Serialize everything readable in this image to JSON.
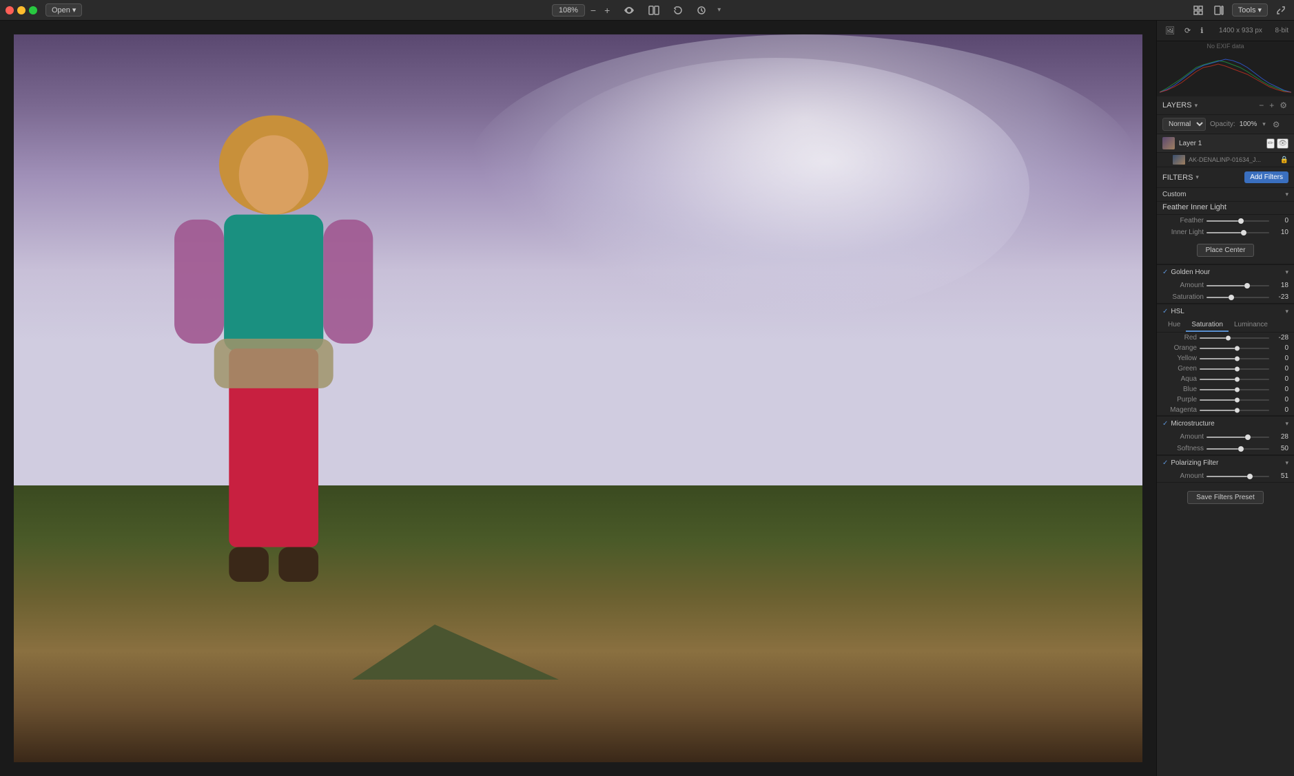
{
  "toolbar": {
    "open_label": "Open",
    "zoom_value": "108%",
    "zoom_minus": "−",
    "zoom_plus": "+",
    "tools_label": "Tools",
    "eye_icon": "👁",
    "compare_icon": "⊟",
    "undo_icon": "↺",
    "clock_icon": "⏱",
    "grid_icon": "⊞",
    "panel_icon": "▦",
    "resize_icon": "⤢"
  },
  "info_bar": {
    "size": "1400 x 933 px",
    "bit": "8-bit",
    "no_exif": "No EXIF data"
  },
  "layers": {
    "title": "LAYERS",
    "blend_mode": "Normal",
    "opacity_label": "Opacity:",
    "opacity_value": "100%",
    "layer1_name": "Layer 1",
    "file_name": "AK-DENALINP-01634_J...",
    "lock_icon": "🔒"
  },
  "filters": {
    "title": "FILTERS",
    "add_btn": "Add Filters",
    "custom_label": "Custom",
    "filter_name": "Feather Inner Light",
    "feather_label": "Feather",
    "feather_value": "0",
    "feather_pct": 50,
    "inner_light_label": "Inner Light",
    "inner_light_value": "10",
    "inner_light_pct": 55,
    "place_center": "Place Center"
  },
  "golden_hour": {
    "title": "Golden Hour",
    "amount_label": "Amount",
    "amount_value": "18",
    "amount_pct": 60,
    "saturation_label": "Saturation",
    "saturation_value": "-23",
    "saturation_pct": 35
  },
  "hsl": {
    "title": "HSL",
    "tabs": [
      "Hue",
      "Saturation",
      "Luminance"
    ],
    "active_tab": 1,
    "colors": [
      {
        "label": "Red",
        "value": "-28",
        "pct": 38
      },
      {
        "label": "Orange",
        "value": "0",
        "pct": 50
      },
      {
        "label": "Yellow",
        "value": "0",
        "pct": 50
      },
      {
        "label": "Green",
        "value": "0",
        "pct": 50
      },
      {
        "label": "Aqua",
        "value": "0",
        "pct": 50
      },
      {
        "label": "Blue",
        "value": "0",
        "pct": 50
      },
      {
        "label": "Purple",
        "value": "0",
        "pct": 50
      },
      {
        "label": "Magenta",
        "value": "0",
        "pct": 50
      }
    ]
  },
  "microstructure": {
    "title": "Microstructure",
    "amount_label": "Amount",
    "amount_value": "28",
    "amount_pct": 62,
    "softness_label": "Softness",
    "softness_value": "50",
    "softness_pct": 50
  },
  "polarizing": {
    "title": "Polarizing Filter",
    "amount_label": "Amount",
    "amount_value": "51",
    "amount_pct": 65
  },
  "save_preset": "Save Filters Preset"
}
